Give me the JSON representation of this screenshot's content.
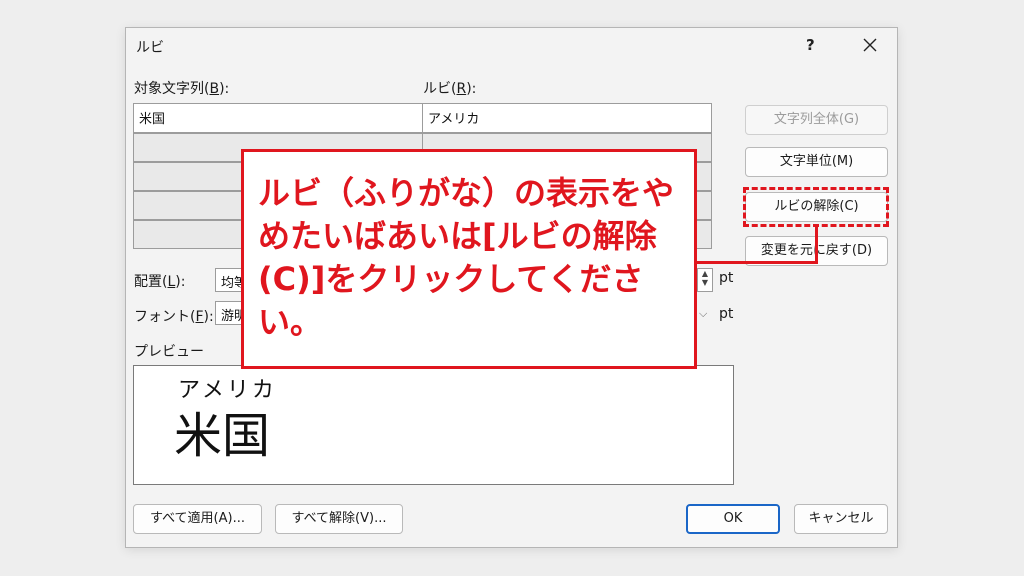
{
  "dialog": {
    "title": "ルビ",
    "help_label": "?",
    "close_icon": "close-icon"
  },
  "labels": {
    "target_text": "対象文字列(",
    "target_key": "B",
    "target_end": "):",
    "ruby": "ルビ(",
    "ruby_key": "R",
    "ruby_end": "):",
    "alignment": "配置(",
    "alignment_key": "L",
    "alignment_end": "):",
    "font": "フォント(",
    "font_key": "F",
    "font_end": "):",
    "preview": "プレビュー"
  },
  "grid": {
    "rows": [
      {
        "base": "米国",
        "ruby": "アメリカ"
      },
      {
        "base": "",
        "ruby": ""
      },
      {
        "base": "",
        "ruby": ""
      },
      {
        "base": "",
        "ruby": ""
      },
      {
        "base": "",
        "ruby": ""
      }
    ]
  },
  "fields": {
    "alignment_value": "均等",
    "font_value": "游明",
    "size_unit": "pt",
    "offset_unit": "pt"
  },
  "buttons": {
    "all_text": "文字列全体(G)",
    "char_unit": "文字単位(M)",
    "remove_ruby": "ルビの解除(C)",
    "revert": "変更を元に戻す(D)",
    "apply_all": "すべて適用(A)...",
    "remove_all": "すべて解除(V)...",
    "ok": "OK",
    "cancel": "キャンセル"
  },
  "preview": {
    "ruby": "アメリカ",
    "base": "米国"
  },
  "callout": {
    "text": "ルビ（ふりがな）の表示をやめたいばあいは[ルビの解除(C)]をクリックしてください。"
  },
  "colors": {
    "annotation": "#e0161e",
    "primary_border": "#1a66c7"
  }
}
